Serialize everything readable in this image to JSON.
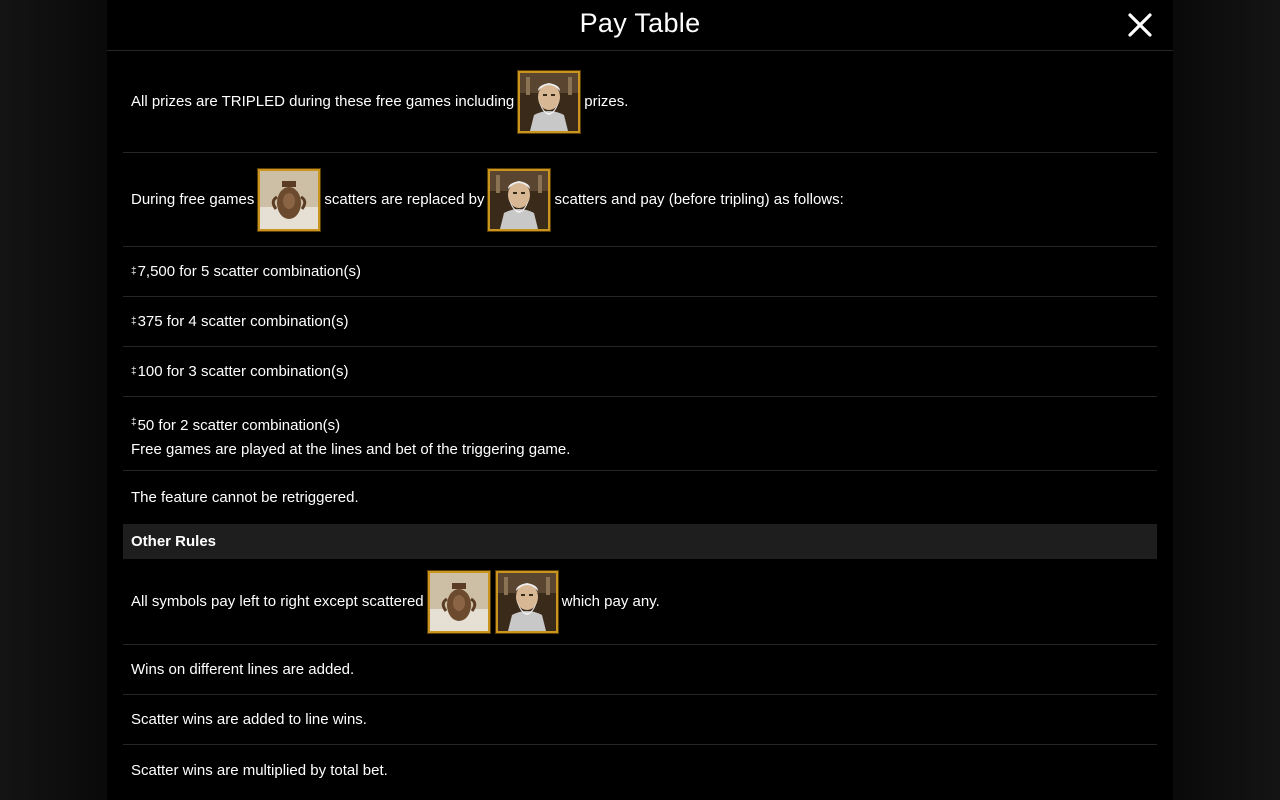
{
  "header": {
    "title": "Pay Table",
    "close_icon": "close-icon"
  },
  "free_games": {
    "tripled_before": "All prizes are TRIPLED during these free games including",
    "tripled_after": "prizes.",
    "replaced_part1": "During free games",
    "replaced_part2": "scatters are replaced by",
    "replaced_part3": "scatters and pay (before tripling) as follows:",
    "currency_mark": "‡",
    "payouts": [
      "7,500 for 5 scatter combination(s)",
      "375 for 4 scatter combination(s)",
      "100 for 3 scatter combination(s)",
      "50 for 2 scatter combination(s)"
    ],
    "lines_note": "Free games are played at the lines and bet of the triggering game.",
    "retrigger_note": "The feature cannot be retriggered."
  },
  "other_rules": {
    "heading": "Other Rules",
    "scatter_rule_before": "All symbols pay left to right except scattered",
    "scatter_rule_after": "which pay any.",
    "rules": [
      "Wins on different lines are added.",
      "Scatter wins are added to line wins.",
      "Scatter wins are multiplied by total bet."
    ]
  },
  "symbols": {
    "zeus": "zeus-symbol-icon",
    "scatter": "clay-pot-scatter-icon"
  },
  "colors": {
    "background": "#000000",
    "divider": "#262626",
    "section_bg": "#1e1e1e",
    "symbol_frame": "#c9951e",
    "text": "#ffffff"
  }
}
